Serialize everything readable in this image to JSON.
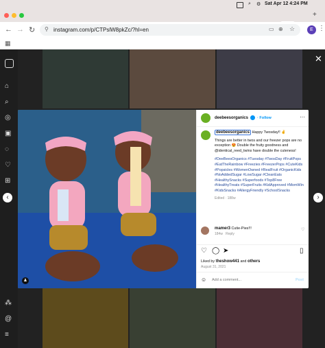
{
  "status_bar": {
    "datetime": "Sat Apr 12 4:24 PM"
  },
  "browser": {
    "tabs": [
      {
        "label": "Ir",
        "color": "#d8336b"
      },
      {
        "label": "X",
        "color": "#111111"
      },
      {
        "label": "X",
        "color": "#111111"
      },
      {
        "label": "Ir",
        "color": "#d8336b"
      },
      {
        "label": "C",
        "color": "#b86a1c"
      },
      {
        "label": "S",
        "color": "#d8336b"
      },
      {
        "label": "Ir",
        "color": "#d8336b"
      },
      {
        "label": "A",
        "color": "#d8336b"
      },
      {
        "label": "Ir",
        "color": "#d8336b"
      },
      {
        "label": "Ir",
        "color": "#d8336b"
      },
      {
        "label": "Ir",
        "color": "#d8336b"
      },
      {
        "label": "Ir",
        "color": "#d8336b"
      },
      {
        "label": "Ir",
        "color": "#d8336b"
      },
      {
        "label": "C",
        "color": "#d8336b",
        "active": true
      }
    ],
    "url": "instagram.com/p/CTPslW8pkZc/?hl=en",
    "profile_initial": "E"
  },
  "post": {
    "username": "deebeesorganics",
    "follow_label": "Follow",
    "more_icon": "more-horizontal-icon",
    "caption_handle": "deebeesorganics",
    "caption_first": "Happy Twosday!! ✌️",
    "caption_body": "Things are better in twos and our freezer pops are no exception 😍 Double the fruity goodness and @identical_reed_twins have double the cuteness!",
    "hashtags": "#DeeBeesOrganics #Tuesday #TwosDay #FruitPops #EatTheRainbow #Freezies #FreezerPops #CuteKids #Popsicles #WomenOwned #RealFruit #OrganicKids #NoAddedSugar #LowSugar #CleanEats #HealthySnacks #Superfoods #Top8Free #HealthyTreats #SuperFruits #KidApproved #MomWin #KidsSnacks #AllergyFriendly #SchoolSnacks",
    "edited": "Edited · 188w",
    "comment": {
      "user": "mamer3",
      "text": "Cutie-Pies!!!",
      "age": "184w",
      "reply_label": "Reply"
    },
    "liked_by_prefix": "Liked by",
    "liked_by_user": "theshow441",
    "liked_by_and": "and",
    "liked_by_others": "others",
    "date": "August 31, 2021",
    "add_comment_placeholder": "Add a comment...",
    "post_button": "Post"
  },
  "colors": {
    "accent_blue": "#0095f6",
    "brand_green": "#6ab023"
  }
}
